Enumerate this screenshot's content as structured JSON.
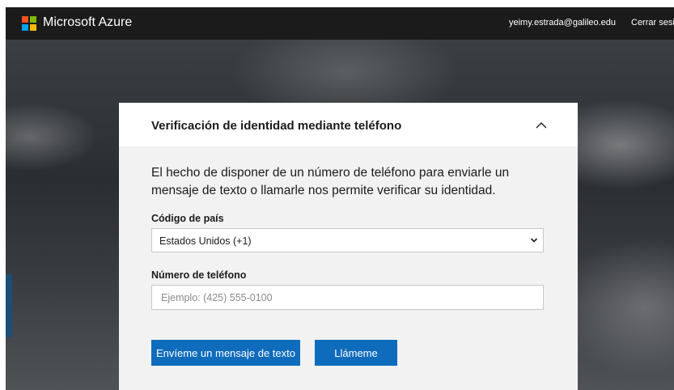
{
  "header": {
    "brand": "Microsoft Azure",
    "user_email": "yeimy.estrada@galileo.edu",
    "sign_out": "Cerrar sesió"
  },
  "panel": {
    "title": "Verificación de identidad mediante teléfono",
    "description": "El hecho de disponer de un número de teléfono para enviarle un mensaje de texto o llamarle nos permite verificar su identidad.",
    "country_label": "Código de país",
    "country_value": "Estados Unidos (+1)",
    "phone_label": "Número de teléfono",
    "phone_placeholder": "Ejemplo: (425) 555-0100",
    "phone_value": "",
    "text_button": "Envíeme un mensaje de texto",
    "call_button": "Llámeme"
  },
  "colors": {
    "accent": "#0f6cbd",
    "topbar": "#1b1b1b",
    "logo": [
      "#f25022",
      "#7fba00",
      "#00a4ef",
      "#ffb900"
    ]
  },
  "icons": {
    "logo": "microsoft-logo-icon",
    "collapse": "chevron-up-icon",
    "dropdown": "chevron-down-icon"
  }
}
